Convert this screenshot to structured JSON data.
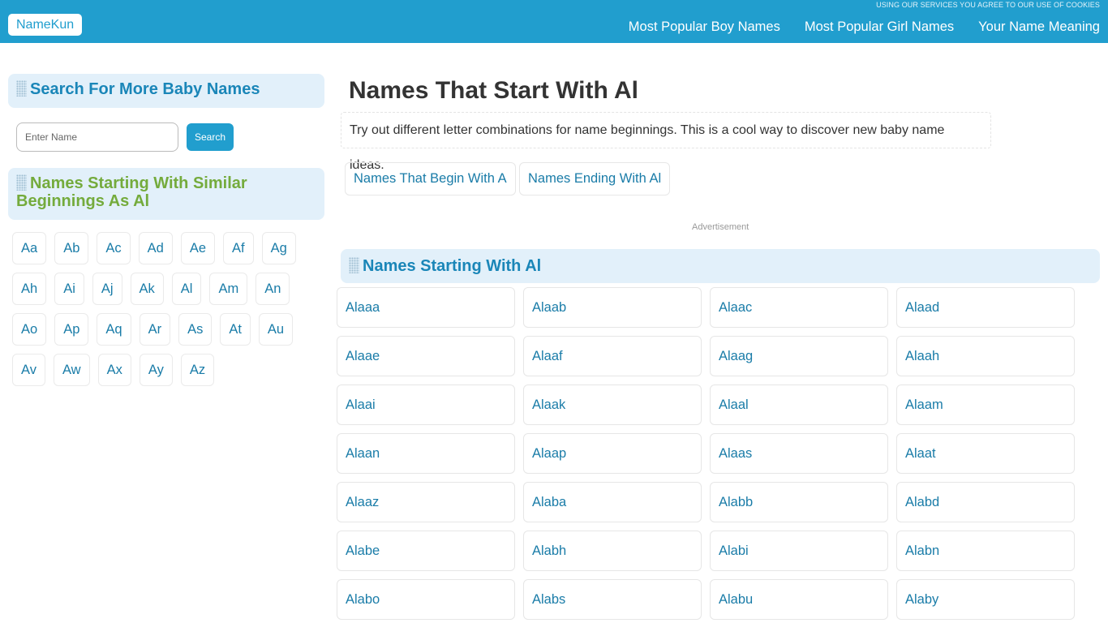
{
  "header": {
    "cookie_note": "USING OUR SERVICES YOU AGREE TO OUR USE OF COOKIES",
    "logo": "NameKun",
    "nav": [
      "Most Popular Boy Names",
      "Most Popular Girl Names",
      "Your Name Meaning"
    ]
  },
  "sidebar": {
    "search_heading": "Search For More Baby Names",
    "search_placeholder": "Enter Name",
    "search_button": "Search",
    "similar_heading": "Names Starting With Similar Beginnings As Al",
    "letter_rows": [
      [
        "Aa",
        "Ab",
        "Ac",
        "Ad",
        "Ae",
        "Af",
        "Ag"
      ],
      [
        "Ah",
        "Ai",
        "Aj",
        "Ak",
        "Al",
        "Am",
        "An"
      ],
      [
        "Ao",
        "Ap",
        "Aq",
        "Ar",
        "As",
        "At",
        "Au"
      ],
      [
        "Av",
        "Aw",
        "Ax",
        "Ay",
        "Az"
      ]
    ]
  },
  "main": {
    "title": "Names That Start With Al",
    "intro": "Try out different letter combinations for name beginnings. This is a cool way to discover new baby name ideas.",
    "links": [
      "Names That Begin With A",
      "Names Ending With Al"
    ],
    "ad_label": "Advertisement",
    "list_heading": "Names Starting With Al",
    "names": [
      [
        "Alaaa",
        "Alaab",
        "Alaac",
        "Alaad"
      ],
      [
        "Alaae",
        "Alaaf",
        "Alaag",
        "Alaah"
      ],
      [
        "Alaai",
        "Alaak",
        "Alaal",
        "Alaam"
      ],
      [
        "Alaan",
        "Alaap",
        "Alaas",
        "Alaat"
      ],
      [
        "Alaaz",
        "Alaba",
        "Alabb",
        "Alabd"
      ],
      [
        "Alabe",
        "Alabh",
        "Alabi",
        "Alabn"
      ],
      [
        "Alabo",
        "Alabs",
        "Alabu",
        "Alaby"
      ]
    ]
  }
}
